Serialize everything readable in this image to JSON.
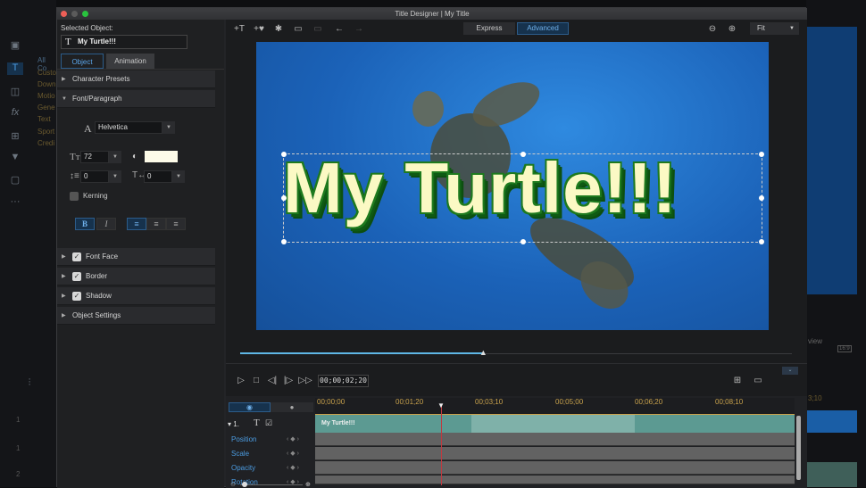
{
  "window": {
    "title": "Title Designer | My Title"
  },
  "background": {
    "categories": [
      "All Co",
      "Custo",
      "Down",
      "Motio",
      "Gene",
      "Text",
      "Sport",
      "Credi"
    ],
    "right_label": "view",
    "aspect": "16:9",
    "ruler_partial": "3;10",
    "track_numbers": [
      "1",
      "1",
      "2"
    ]
  },
  "left_panel": {
    "selected_object_label": "Selected Object:",
    "selected_object_value": "My Turtle!!!",
    "tabs": [
      {
        "label": "Object",
        "active": true
      },
      {
        "label": "Animation",
        "active": false
      }
    ],
    "sections": {
      "character_presets": "Character Presets",
      "font_paragraph": "Font/Paragraph",
      "font_face": "Font Face",
      "border": "Border",
      "shadow": "Shadow",
      "object_settings": "Object Settings"
    },
    "font": "Helvetica",
    "size": "72",
    "line_spacing": "0",
    "char_spacing": "0",
    "kerning_label": "Kerning",
    "bold": "B",
    "italic": "I",
    "font_color": "#fdfbe8"
  },
  "toolbar": {
    "modes": [
      {
        "label": "Express",
        "active": false
      },
      {
        "label": "Advanced",
        "active": true
      }
    ],
    "zoom": "Fit"
  },
  "canvas": {
    "text": "My Turtle!!!",
    "scrub_progress": 0.44
  },
  "playback": {
    "timecode": "00;00;02;20"
  },
  "timeline": {
    "ruler": [
      "00;00;00",
      "00;01;20",
      "00;03;10",
      "00;05;00",
      "00;06;20",
      "00;08;10"
    ],
    "track_number": "1.",
    "clip_label": "My Turtle!!!",
    "params": [
      "Position",
      "Scale",
      "Opacity",
      "Rotation"
    ]
  },
  "colors": {
    "accent": "#4b9be0",
    "clip": "#5c9a92",
    "playhead": "#c0393f"
  }
}
